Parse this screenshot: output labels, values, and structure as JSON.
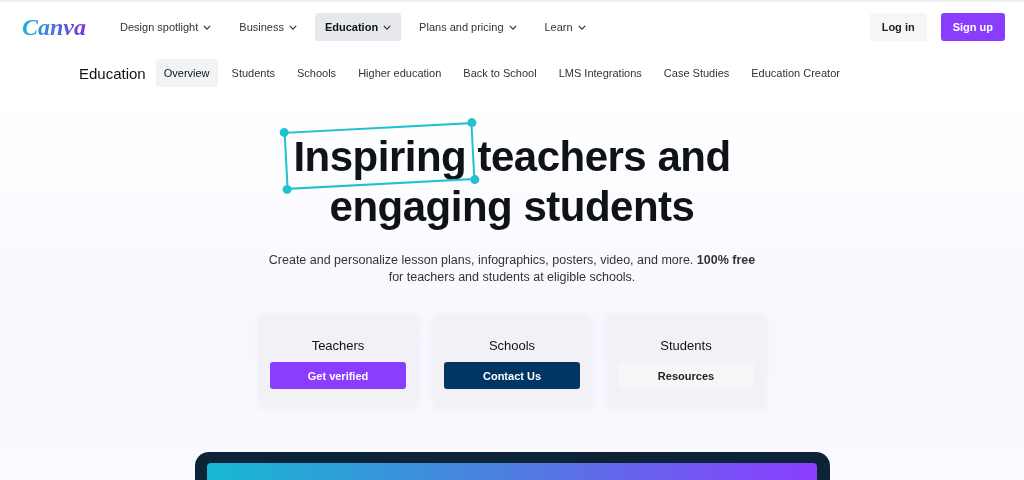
{
  "header": {
    "logo": "Canva",
    "nav": [
      {
        "label": "Design spotlight",
        "selected": false
      },
      {
        "label": "Business",
        "selected": false
      },
      {
        "label": "Education",
        "selected": true
      },
      {
        "label": "Plans and pricing",
        "selected": false
      },
      {
        "label": "Learn",
        "selected": false
      }
    ],
    "buttons": [
      {
        "label": "Log in",
        "kind": "light"
      },
      {
        "label": "Sign up",
        "kind": "primary"
      }
    ]
  },
  "subnav": {
    "title": "Education",
    "tabs": [
      {
        "label": "Overview",
        "selected": true
      },
      {
        "label": "Students",
        "selected": false
      },
      {
        "label": "Schools",
        "selected": false
      },
      {
        "label": "Higher education",
        "selected": false
      },
      {
        "label": "Back to School",
        "selected": false
      },
      {
        "label": "LMS Integrations",
        "selected": false
      },
      {
        "label": "Case Studies",
        "selected": false
      },
      {
        "label": "Education Creator",
        "selected": false
      }
    ]
  },
  "hero": {
    "title": [
      {
        "text": "Inspiring",
        "highlighted": true
      },
      {
        "text": "teachers and",
        "highlighted": false
      },
      {
        "text": "engaging students",
        "highlighted": false
      }
    ],
    "subtitle": "Create and personalize lesson plans, infographics, posters, video, and more. **100% free** for teachers and students at eligible schools.",
    "cards": [
      {
        "title": "Teachers",
        "button": "Get verified",
        "kind": "primary"
      },
      {
        "title": "Schools",
        "button": "Contact Us",
        "kind": "dark"
      },
      {
        "title": "Students",
        "button": "Resources",
        "kind": "light"
      }
    ]
  }
}
